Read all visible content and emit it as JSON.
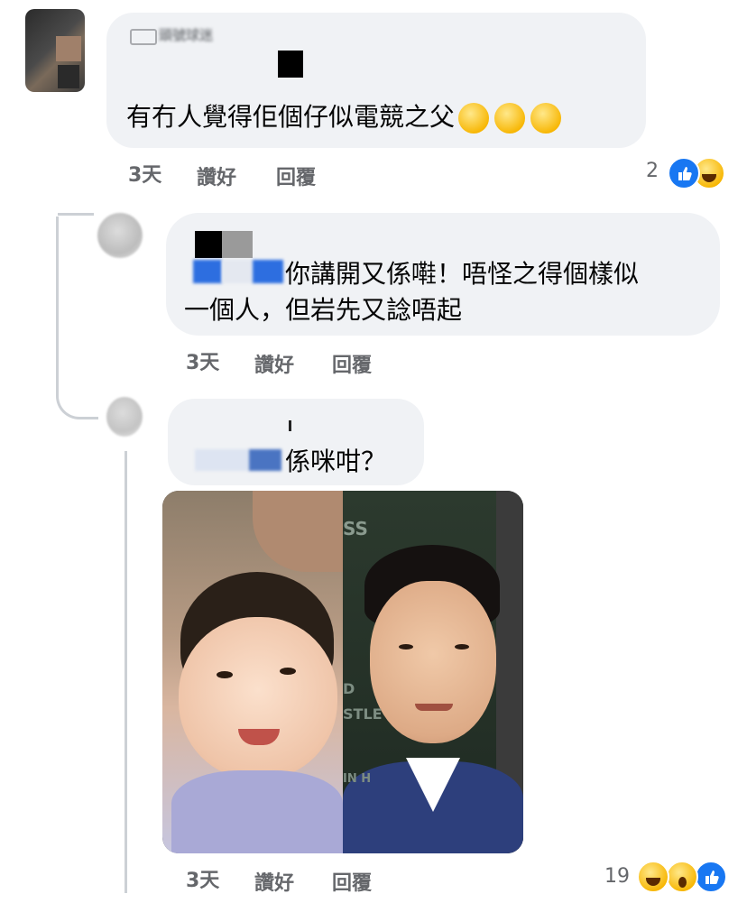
{
  "comments": [
    {
      "name": "頭號球迷",
      "text": "有冇人覺得佢個仔似電競之父",
      "emoji": [
        "😅",
        "😅",
        "😅"
      ],
      "time": "3天",
      "like": "讚好",
      "reply": "回覆",
      "reaction_count": "2",
      "reaction_icons": [
        "like-reaction",
        "haha-reaction"
      ]
    }
  ],
  "replies": [
    {
      "text_line1": "你講開又係嚡！唔怪之得個樣似",
      "text_line2": "一個人，但岩先又諗唔起",
      "time": "3天",
      "like": "讚好",
      "reply": "回覆"
    },
    {
      "text": "係咪咁？",
      "photo_overlay": [
        "SS",
        "D",
        "STLE",
        "IN H"
      ],
      "time": "3天",
      "like": "讚好",
      "reply": "回覆",
      "reaction_count": "19",
      "reaction_icons": [
        "haha-reaction",
        "wow-reaction",
        "like-reaction"
      ]
    }
  ],
  "colors": {
    "bubble": "#f0f2f5",
    "meta_text": "#65676b",
    "like_blue": "#1877f2",
    "emoji_yellow": "#f7b500",
    "thread_line": "#ccd0d5"
  }
}
